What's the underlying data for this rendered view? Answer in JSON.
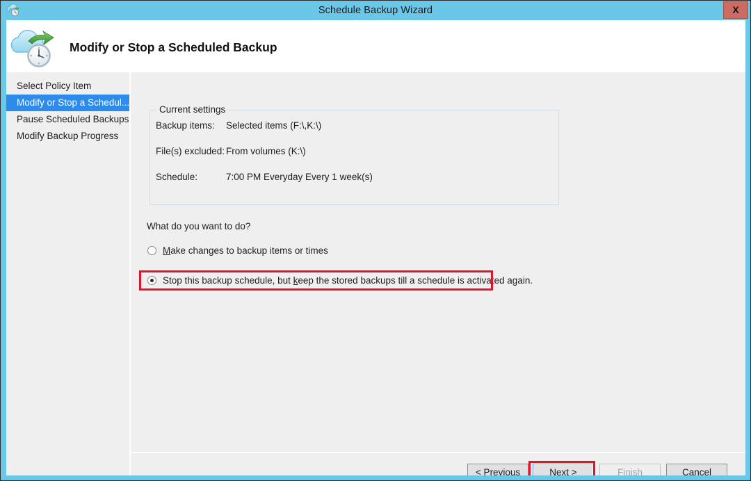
{
  "window": {
    "title": "Schedule Backup Wizard",
    "icon": "cloud-clock-icon",
    "close_label": "X",
    "frame_color": "#6ac7e8"
  },
  "header": {
    "title": "Modify or Stop a Scheduled Backup",
    "icon": "cloud-backup-clock-icon"
  },
  "sidebar": {
    "items": [
      {
        "label": "Select Policy Item",
        "selected": false
      },
      {
        "label": "Modify or Stop a Schedul...",
        "selected": true
      },
      {
        "label": "Pause Scheduled Backups",
        "selected": false
      },
      {
        "label": "Modify Backup Progress",
        "selected": false
      }
    ],
    "selected_color": "#2d8ceb"
  },
  "settings": {
    "legend": "Current settings",
    "rows": [
      {
        "label": "Backup items:",
        "value": "Selected items (F:\\,K:\\)"
      },
      {
        "label": "File(s) excluded:",
        "value": "From volumes (K:\\)"
      },
      {
        "label": "Schedule:",
        "value": "7:00 PM Everyday Every 1 week(s)"
      }
    ]
  },
  "question": {
    "prompt": "What do you want to do?",
    "options": [
      {
        "mnemonic_before": "",
        "mnemonic": "M",
        "text_after": "ake changes to backup items or times",
        "selected": false
      },
      {
        "mnemonic_before": "Stop this backup schedule, but ",
        "mnemonic": "k",
        "text_after": "eep the stored backups till a schedule is activated again.",
        "selected": true
      }
    ]
  },
  "footer": {
    "buttons": [
      {
        "prefix": "< ",
        "mnemonic": "P",
        "suffix": "revious",
        "state": "enabled",
        "highlighted": false
      },
      {
        "prefix": "",
        "mnemonic": "N",
        "suffix": "ext >",
        "state": "focused",
        "highlighted": true
      },
      {
        "prefix": "",
        "mnemonic": "F",
        "suffix": "inish",
        "state": "disabled",
        "highlighted": false
      },
      {
        "prefix": "",
        "mnemonic": "C",
        "suffix": "ancel",
        "state": "enabled",
        "highlighted": false
      }
    ]
  },
  "annotations": {
    "color": "#e8122a",
    "targets": [
      "stop-schedule-radio",
      "next-button"
    ]
  }
}
